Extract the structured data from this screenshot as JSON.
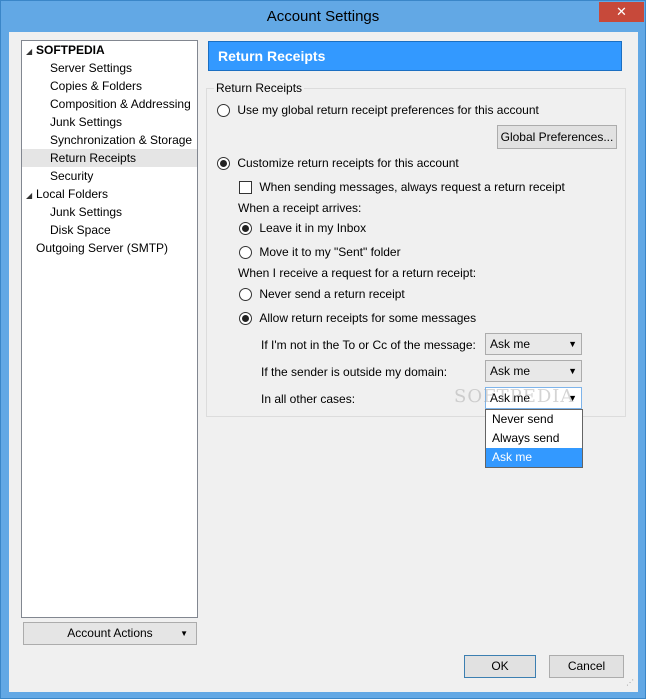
{
  "window": {
    "title": "Account Settings",
    "close_glyph": "✕"
  },
  "tree": {
    "items": [
      {
        "label": "SOFTPEDIA",
        "level": 0,
        "expanded": true,
        "bold": true
      },
      {
        "label": "Server Settings",
        "level": 1
      },
      {
        "label": "Copies & Folders",
        "level": 1
      },
      {
        "label": "Composition & Addressing",
        "level": 1
      },
      {
        "label": "Junk Settings",
        "level": 1
      },
      {
        "label": "Synchronization & Storage",
        "level": 1
      },
      {
        "label": "Return Receipts",
        "level": 1,
        "selected": true
      },
      {
        "label": "Security",
        "level": 1
      },
      {
        "label": "Local Folders",
        "level": 0,
        "expanded": true
      },
      {
        "label": "Junk Settings",
        "level": 1
      },
      {
        "label": "Disk Space",
        "level": 1
      },
      {
        "label": "Outgoing Server (SMTP)",
        "level": 0
      }
    ]
  },
  "account_actions": {
    "label": "Account Actions"
  },
  "panel": {
    "title": "Return Receipts",
    "group_label": "Return Receipts",
    "use_global_label": "Use my global return receipt preferences for this account",
    "global_prefs_button": "Global Preferences...",
    "customize_label": "Customize return receipts for this account",
    "always_request_label": "When sending messages, always request a return receipt",
    "when_arrives_label": "When a receipt arrives:",
    "leave_inbox_label": "Leave it in my Inbox",
    "move_sent_label": "Move it to my \"Sent\" folder",
    "when_request_label": "When I receive a request for a return receipt:",
    "never_send_label": "Never send a return receipt",
    "allow_some_label": "Allow return receipts for some messages",
    "not_in_to_label": "If I'm not in the To or Cc of the message:",
    "outside_domain_label": "If the sender is outside my domain:",
    "other_cases_label": "In all other cases:",
    "not_in_to_value": "Ask me",
    "outside_domain_value": "Ask me",
    "other_cases_value": "Ask me",
    "dropdown_options": [
      "Never send",
      "Always send",
      "Ask me"
    ],
    "dropdown_selected": "Ask me"
  },
  "buttons": {
    "ok": "OK",
    "cancel": "Cancel"
  },
  "watermark": "SOFTPEDIA",
  "colors": {
    "titlebar": "#62a8e5",
    "header": "#3399ff",
    "close": "#c7493a",
    "selection": "#3399ff"
  }
}
